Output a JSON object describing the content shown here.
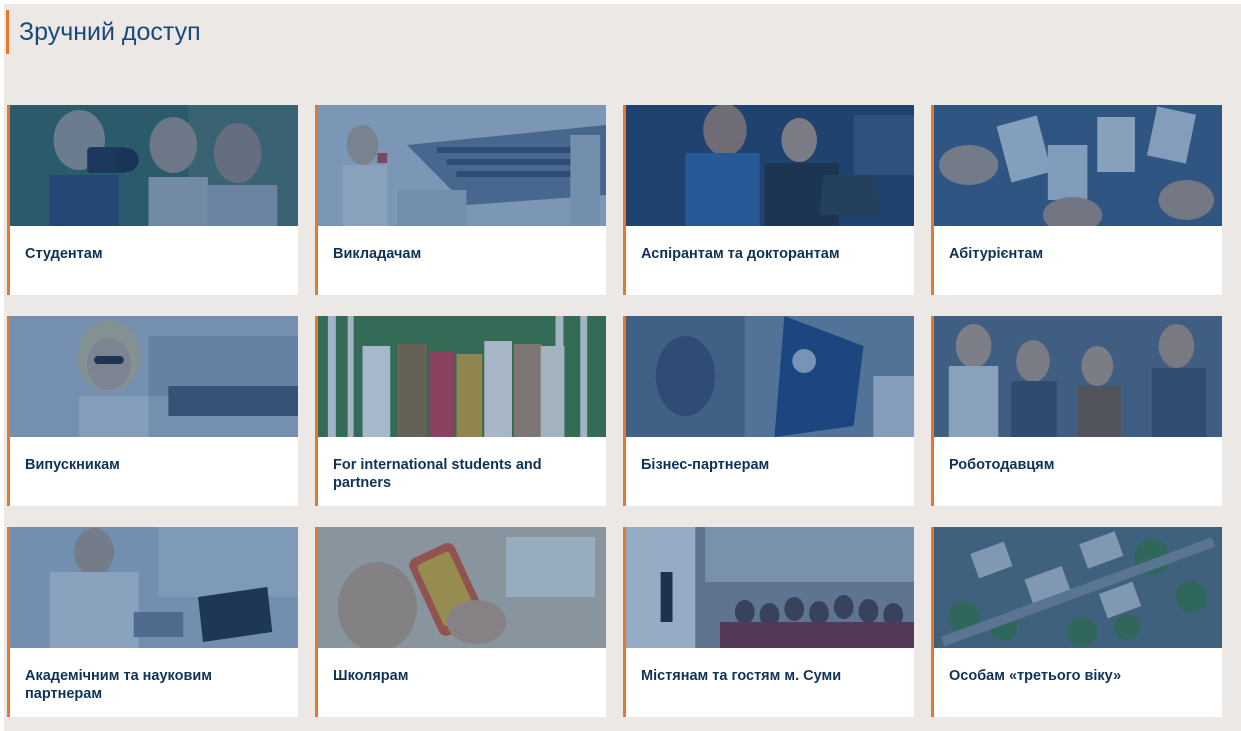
{
  "section": {
    "title": "Зручний доступ"
  },
  "colors": {
    "accent": "#e8772e",
    "title": "#1b4a7a",
    "label": "#0f3356",
    "background": "#ebe8e6",
    "image_overlay": "#1f4f86"
  },
  "cards": [
    {
      "label": "Студентам",
      "image": "students-with-camera-photo"
    },
    {
      "label": "Викладачам",
      "image": "lecture-hall-photo"
    },
    {
      "label": "Аспірантам та докторантам",
      "image": "researchers-at-laptop-photo"
    },
    {
      "label": "Абітурієнтам",
      "image": "hands-holding-cards-photo"
    },
    {
      "label": "Випускникам",
      "image": "graduate-in-office-photo"
    },
    {
      "label": "For international students and partners",
      "image": "international-students-group-photo"
    },
    {
      "label": "Бізнес-партнерам",
      "image": "business-flag-photo"
    },
    {
      "label": "Роботодавцям",
      "image": "young-people-meeting-photo"
    },
    {
      "label": "Академічним та науковим партнерам",
      "image": "scientist-at-laboratory-photo"
    },
    {
      "label": "Школярам",
      "image": "phone-game-photo"
    },
    {
      "label": "Містянам та гостям м. Суми",
      "image": "public-event-hall-photo"
    },
    {
      "label": "Особам «третього віку»",
      "image": "aerial-city-view-photo"
    }
  ]
}
